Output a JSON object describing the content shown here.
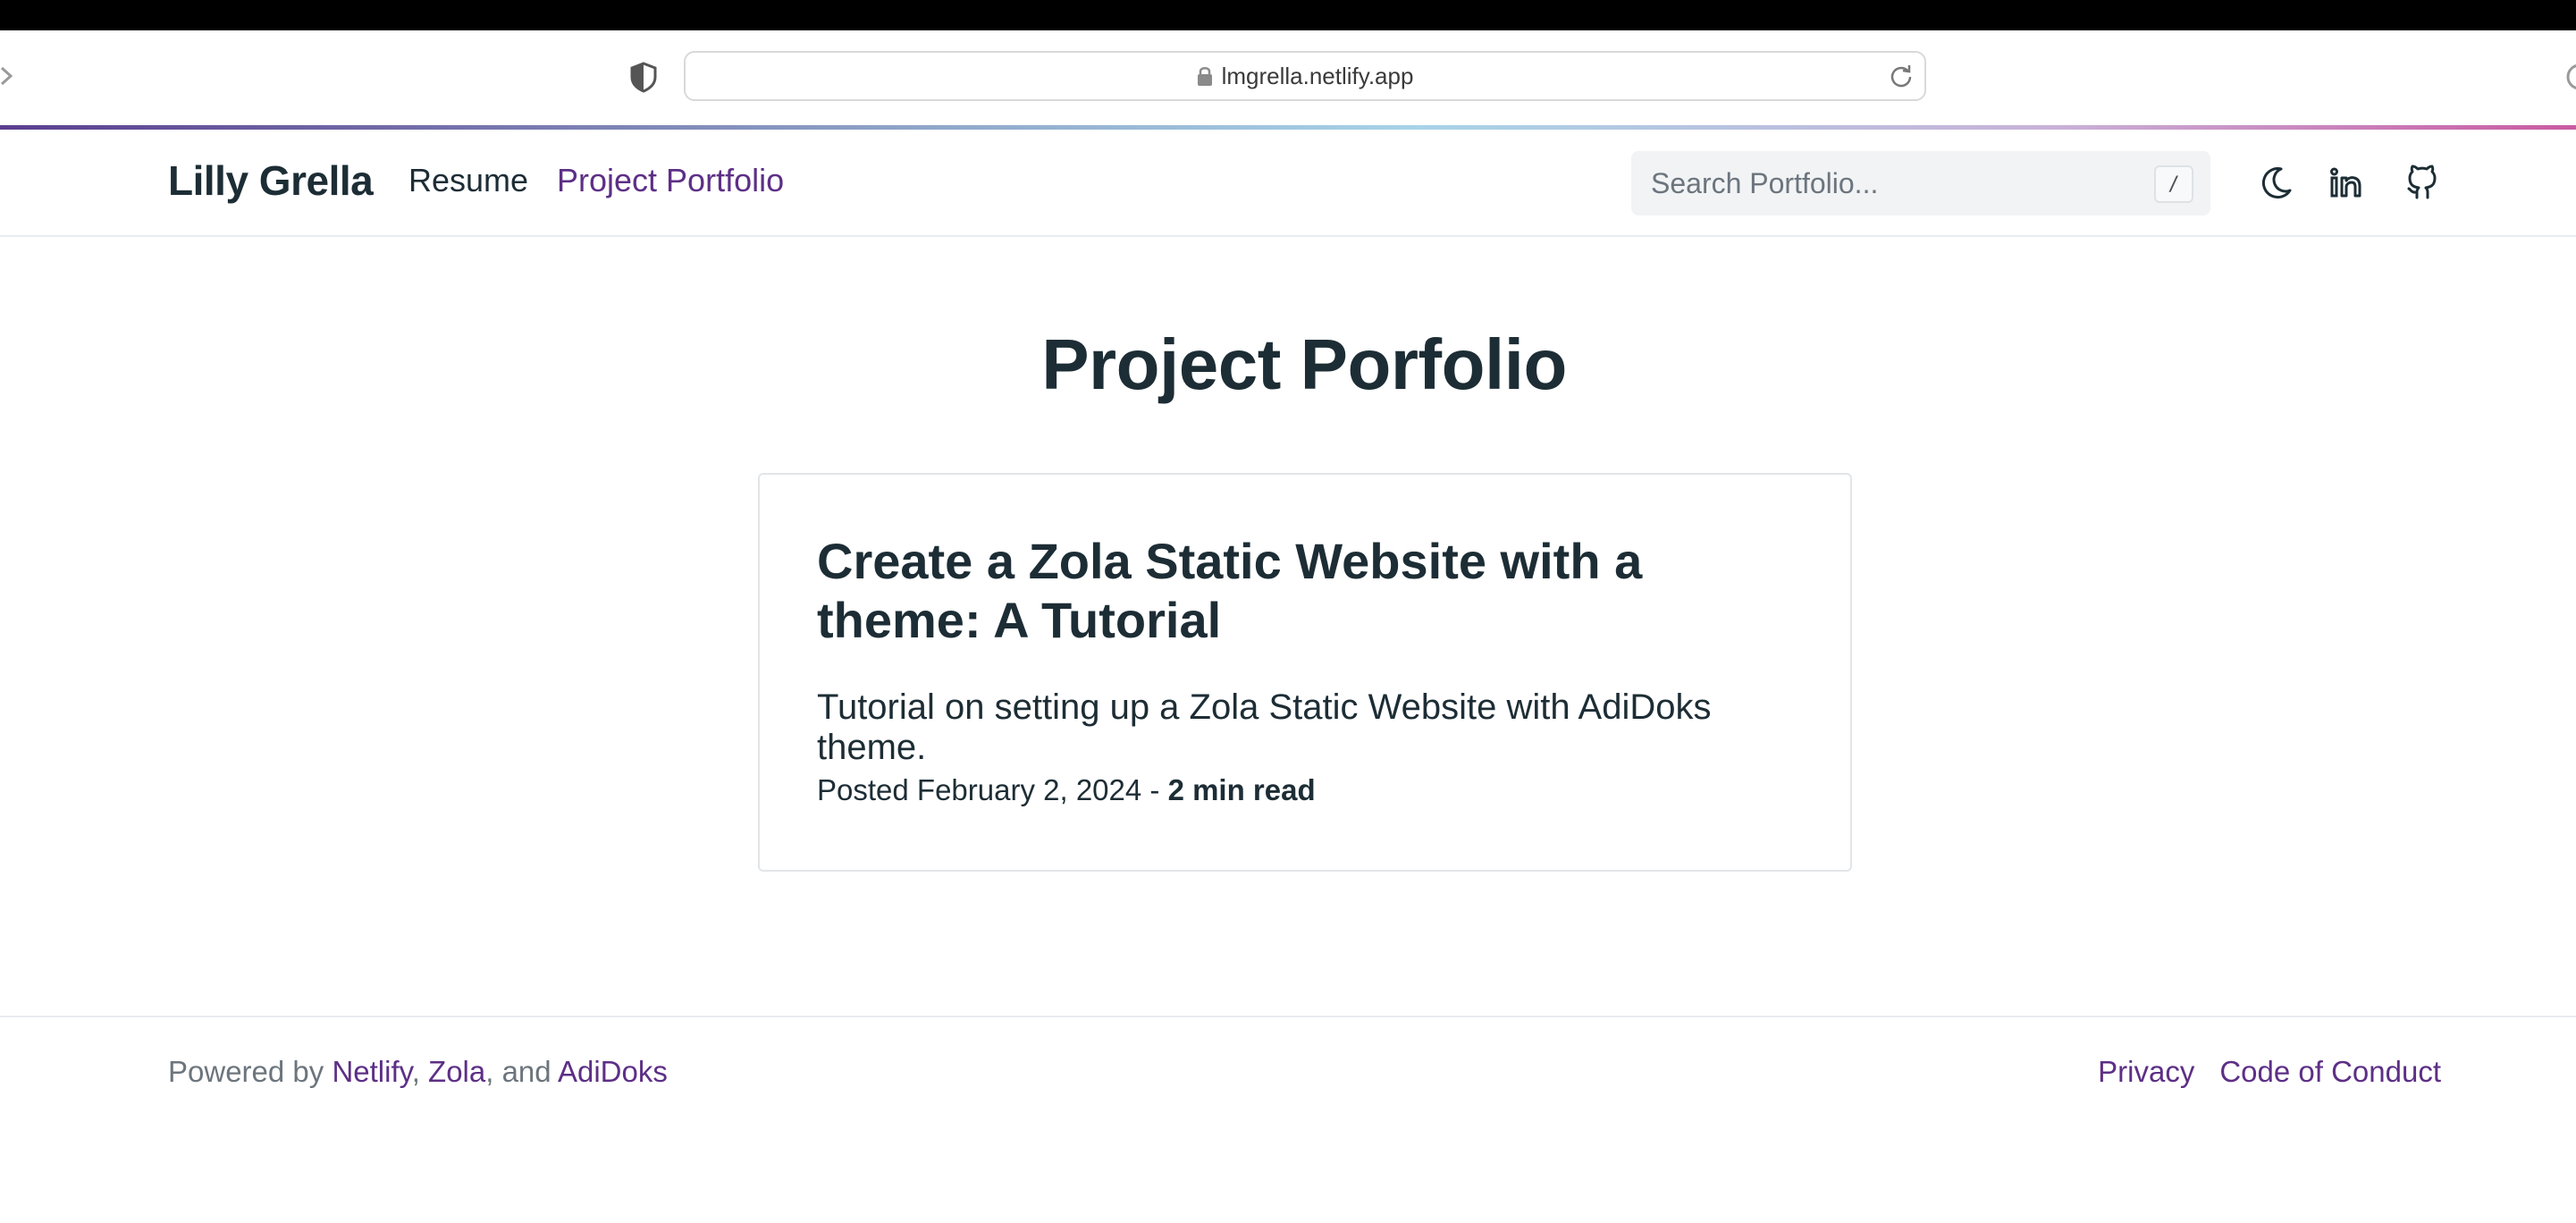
{
  "browser": {
    "url": "lmgrella.netlify.app"
  },
  "site": {
    "brand": "Lilly Grella",
    "nav": [
      {
        "label": "Resume",
        "active": false
      },
      {
        "label": "Project Portfolio",
        "active": true
      }
    ],
    "search": {
      "placeholder": "Search Portfolio...",
      "shortcut": "/"
    },
    "icons": [
      "moon-icon",
      "linkedin-icon",
      "github-icon"
    ]
  },
  "main": {
    "title": "Project Porfolio",
    "posts": [
      {
        "title": "Create a Zola Static Website with a theme: A Tutorial",
        "description": "Tutorial on setting up a Zola Static Website with AdiDoks theme.",
        "posted_prefix": "Posted February 2, 2024 - ",
        "read_time": "2 min read"
      }
    ]
  },
  "footer": {
    "powered_by": "Powered by ",
    "links": [
      "Netlify",
      "Zola",
      "AdiDoks"
    ],
    "sep_comma": ", ",
    "sep_and": ", and ",
    "right_links": [
      "Privacy",
      "Code of Conduct"
    ]
  },
  "colors": {
    "accent": "#5d2f86",
    "text": "#1d2d35",
    "muted": "#6c757d"
  }
}
